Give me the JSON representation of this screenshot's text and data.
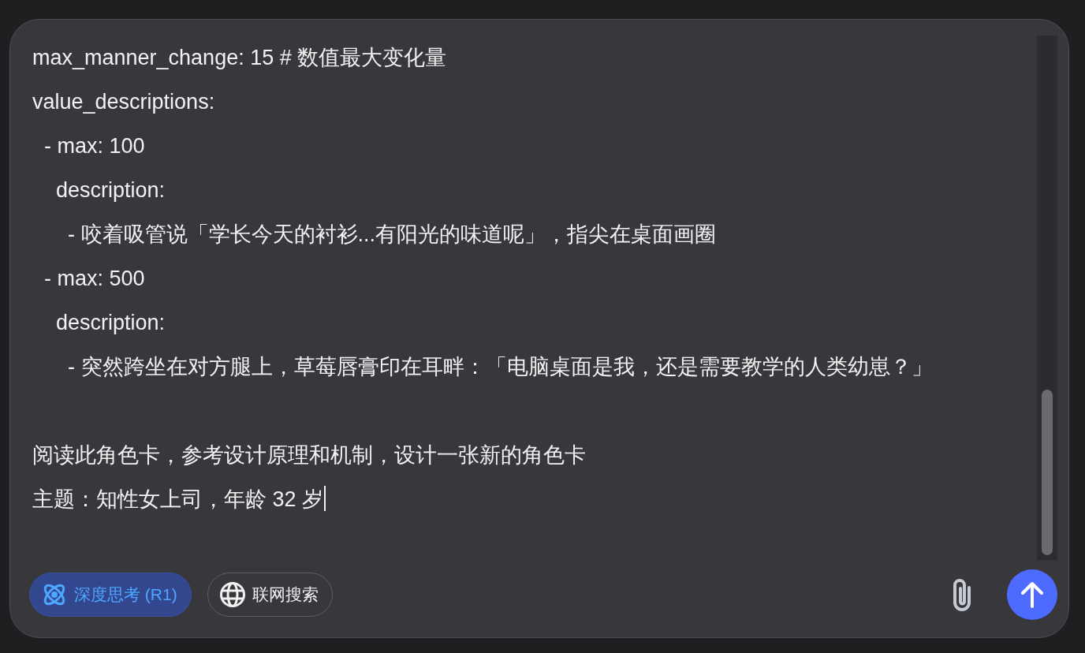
{
  "editor": {
    "lines": [
      {
        "kind": "text",
        "text": "max_manner_change: 15 # 数值最大变化量"
      },
      {
        "kind": "text",
        "text": "value_descriptions:"
      },
      {
        "kind": "text",
        "text": "  - max: 100"
      },
      {
        "kind": "text",
        "text": "    description:"
      },
      {
        "kind": "text",
        "text": "      - 咬着吸管说「学长今天的衬衫...有阳光的味道呢」，指尖在桌面画圈"
      },
      {
        "kind": "text",
        "text": "  - max: 500"
      },
      {
        "kind": "text",
        "text": "    description:"
      },
      {
        "kind": "text",
        "text": "      - 突然跨坐在对方腿上，草莓唇膏印在耳畔：「电脑桌面是我，还是需要教学的人类幼崽？」"
      },
      {
        "kind": "blank"
      },
      {
        "kind": "text",
        "text": "阅读此角色卡，参考设计原理和机制，设计一张新的角色卡"
      },
      {
        "kind": "caret",
        "text": "主题：知性女上司，年龄 32 岁"
      }
    ]
  },
  "toolbar": {
    "toggles": [
      {
        "label": "深度思考 (R1)",
        "kind": "deep-think",
        "selected": true
      },
      {
        "label": "联网搜索",
        "kind": "web-search",
        "selected": false
      }
    ]
  }
}
